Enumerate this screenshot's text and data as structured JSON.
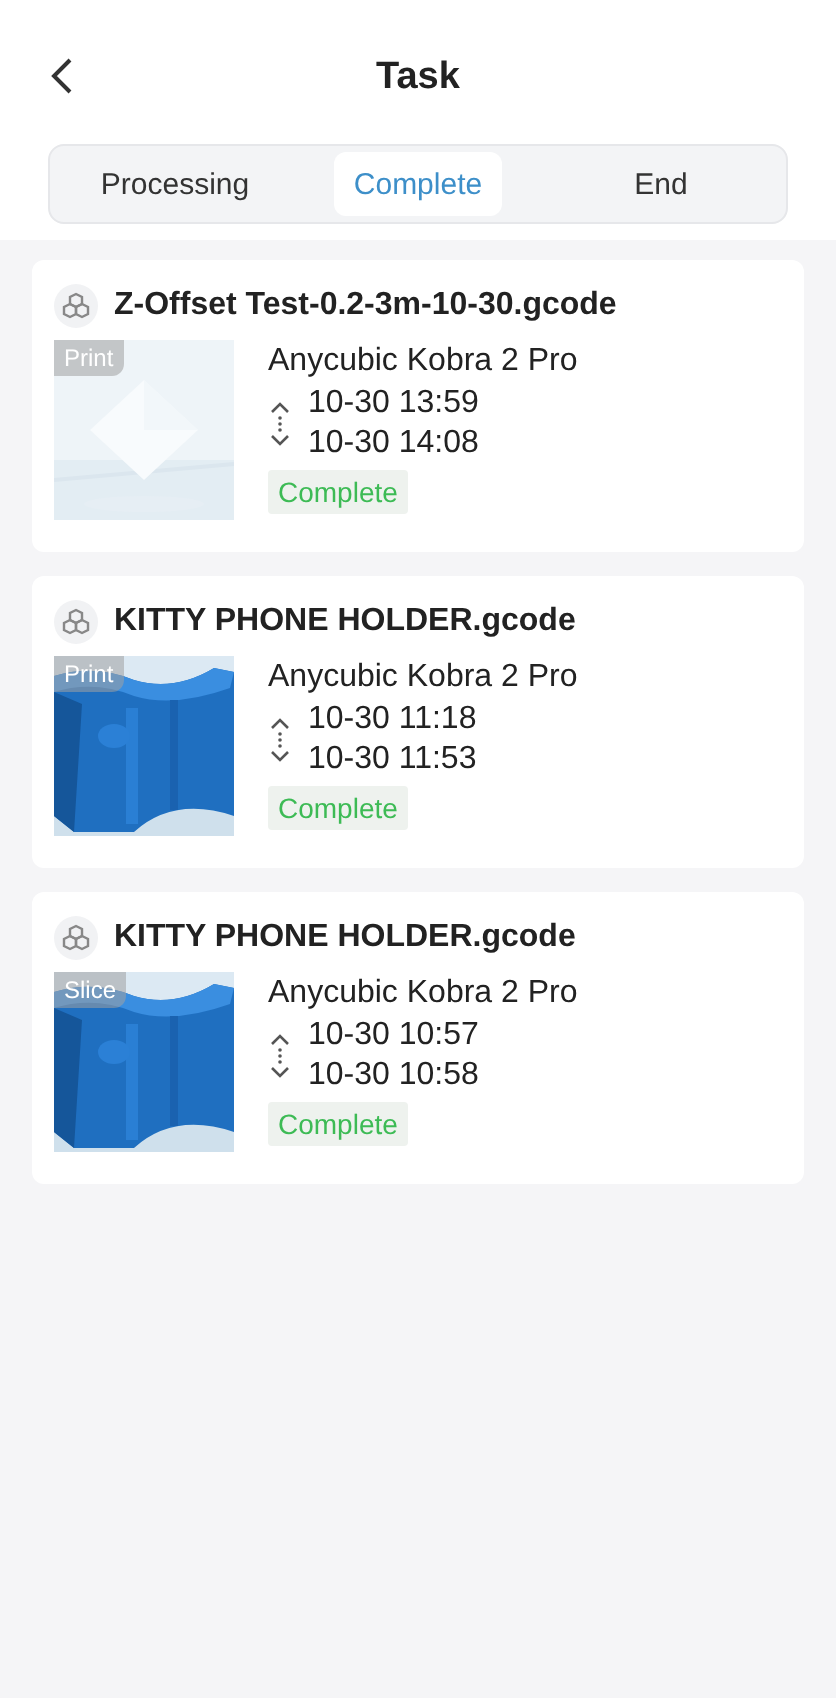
{
  "header": {
    "title": "Task"
  },
  "tabs": [
    {
      "label": "Processing",
      "selected": false
    },
    {
      "label": "Complete",
      "selected": true
    },
    {
      "label": "End",
      "selected": false
    }
  ],
  "tasks": [
    {
      "file": "Z-Offset Test-0.2-3m-10-30.gcode",
      "tag": "Print",
      "printer": "Anycubic Kobra 2 Pro",
      "start": "10-30 13:59",
      "end": "10-30 14:08",
      "status": "Complete"
    },
    {
      "file": "KITTY PHONE HOLDER.gcode",
      "tag": "Print",
      "printer": "Anycubic Kobra 2 Pro",
      "start": "10-30 11:18",
      "end": "10-30 11:53",
      "status": "Complete"
    },
    {
      "file": "KITTY PHONE HOLDER.gcode",
      "tag": "Slice",
      "printer": "Anycubic Kobra 2 Pro",
      "start": "10-30 10:57",
      "end": "10-30 10:58",
      "status": "Complete"
    }
  ]
}
